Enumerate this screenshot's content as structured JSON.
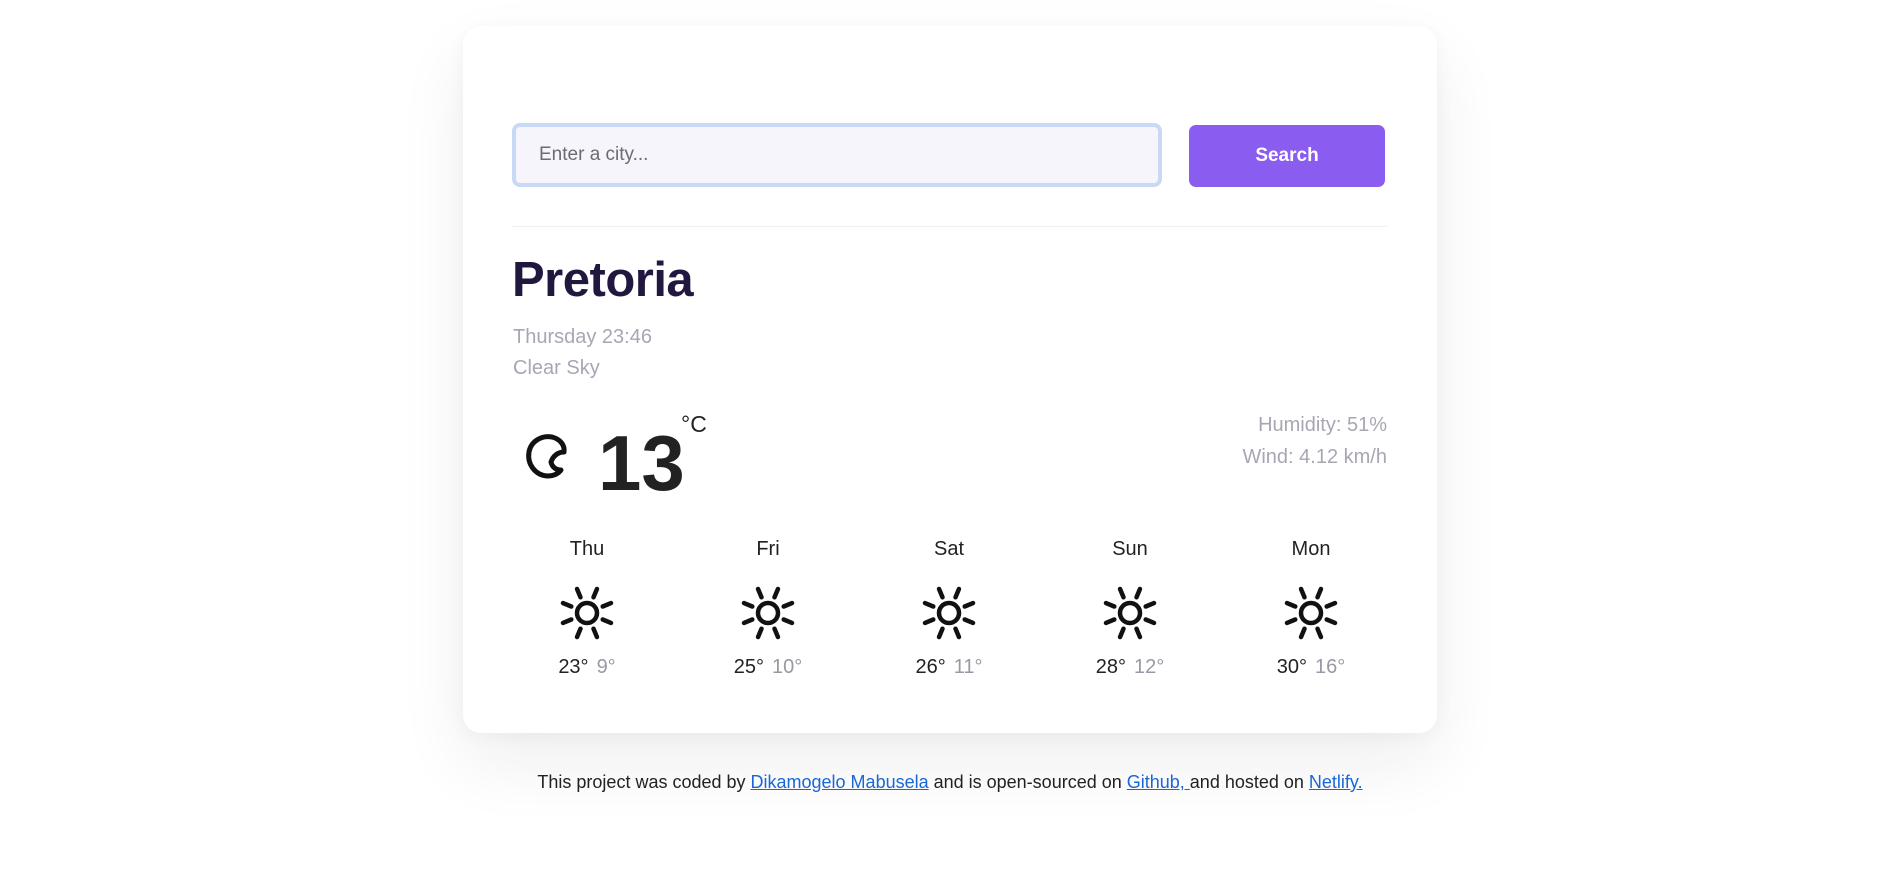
{
  "search": {
    "placeholder": "Enter a city...",
    "value": "",
    "button_label": "Search"
  },
  "current": {
    "city": "Pretoria",
    "date": "Thursday 23:46",
    "description": "Clear Sky",
    "icon": "clear-night-moon-icon",
    "temperature": "13",
    "unit": "°C",
    "humidity": "Humidity: 51%",
    "wind": "Wind: 4.12 km/h"
  },
  "forecast": [
    {
      "day": "Thu",
      "icon": "sun-icon",
      "max": "23°",
      "min": "9°"
    },
    {
      "day": "Fri",
      "icon": "sun-icon",
      "max": "25°",
      "min": "10°"
    },
    {
      "day": "Sat",
      "icon": "sun-icon",
      "max": "26°",
      "min": "11°"
    },
    {
      "day": "Sun",
      "icon": "sun-icon",
      "max": "28°",
      "min": "12°"
    },
    {
      "day": "Mon",
      "icon": "sun-icon",
      "max": "30°",
      "min": "16°"
    }
  ],
  "footer": {
    "text_1": "This project was coded by ",
    "author_link": "Dikamogelo Mabusela",
    "text_2": " and is open-sourced on ",
    "github_link": "Github, ",
    "text_3": "and hosted on ",
    "netlify_link": "Netlify."
  },
  "colors": {
    "accent": "#8a5cf0",
    "city_title": "#22183f",
    "muted_text": "#a9a6b3",
    "link": "#1a66d6",
    "input_border": "#c8d9f6",
    "input_bg": "#f6f5fc"
  }
}
